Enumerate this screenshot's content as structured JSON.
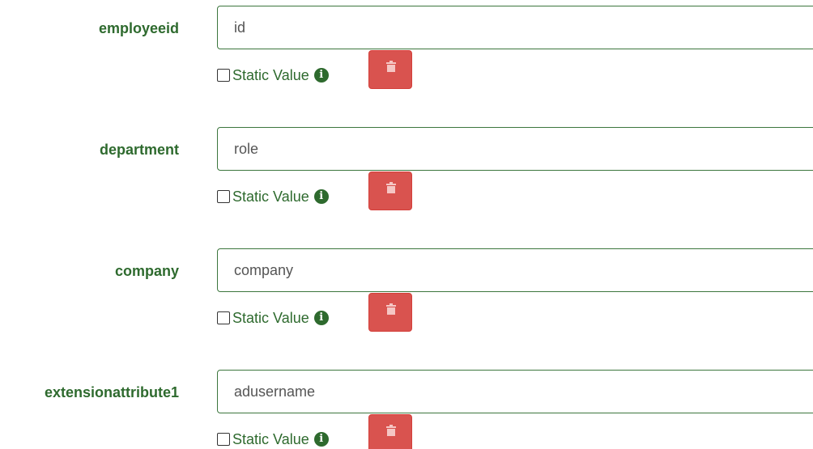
{
  "mappings": [
    {
      "label": "employeeid",
      "value": "id",
      "static_label": "Static Value"
    },
    {
      "label": "department",
      "value": "role",
      "static_label": "Static Value"
    },
    {
      "label": "company",
      "value": "company",
      "static_label": "Static Value"
    },
    {
      "label": "extensionattribute1",
      "value": "adusername",
      "static_label": "Static Value"
    }
  ],
  "icons": {
    "info": "info-circle-icon",
    "trash": "trash-icon"
  },
  "colors": {
    "label_text": "#2e6a2e",
    "input_border": "#3c763d",
    "delete_button": "#d9534f"
  }
}
